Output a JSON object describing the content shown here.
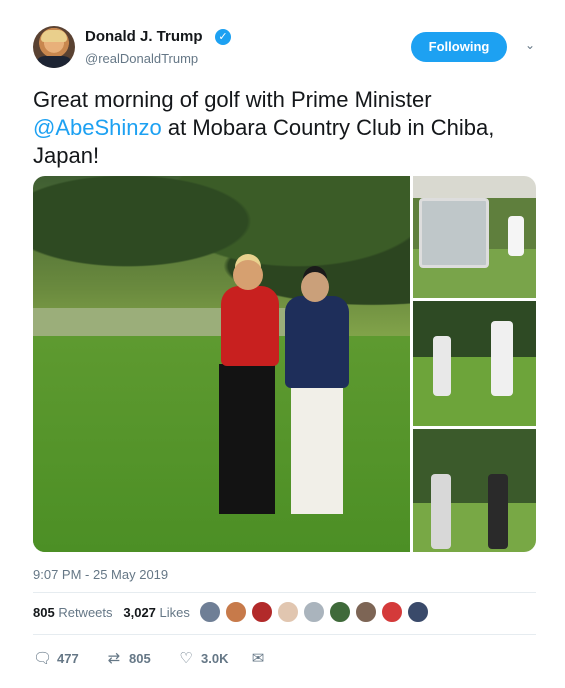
{
  "author": {
    "name": "Donald J. Trump",
    "handle": "@realDonaldTrump",
    "verified_icon": "verified-badge-icon"
  },
  "follow_button": {
    "label": "Following"
  },
  "tweet": {
    "text_before": "Great morning of golf with Prime Minister ",
    "mention": "@AbeShinzo",
    "text_after": " at Mobara Country Club in Chiba, Japan!"
  },
  "timestamp": "9:07 PM - 25 May 2019",
  "stats": {
    "retweets_count": "805",
    "retweets_label": "Retweets",
    "likes_count": "3,027",
    "likes_label": "Likes"
  },
  "actions": {
    "reply_count": "477",
    "retweet_count": "805",
    "like_count": "3.0K"
  },
  "colors": {
    "accent": "#1da1f2",
    "text": "#14171a",
    "muted": "#657786"
  }
}
